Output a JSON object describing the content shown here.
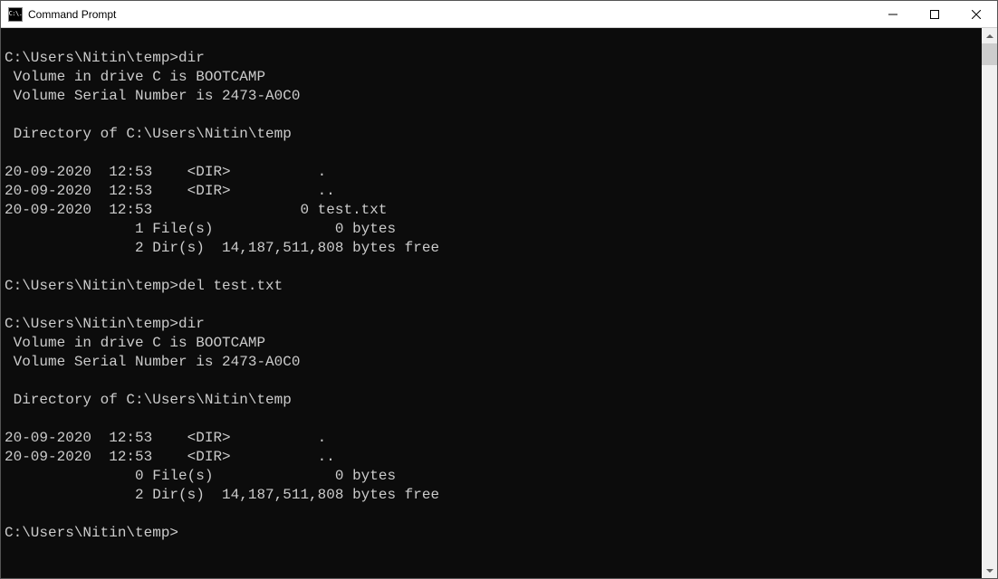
{
  "window": {
    "title": "Command Prompt",
    "icon_text": "C:\\."
  },
  "terminal": {
    "lines": [
      "",
      "C:\\Users\\Nitin\\temp>dir",
      " Volume in drive C is BOOTCAMP",
      " Volume Serial Number is 2473-A0C0",
      "",
      " Directory of C:\\Users\\Nitin\\temp",
      "",
      "20-09-2020  12:53    <DIR>          .",
      "20-09-2020  12:53    <DIR>          ..",
      "20-09-2020  12:53                 0 test.txt",
      "               1 File(s)              0 bytes",
      "               2 Dir(s)  14,187,511,808 bytes free",
      "",
      "C:\\Users\\Nitin\\temp>del test.txt",
      "",
      "C:\\Users\\Nitin\\temp>dir",
      " Volume in drive C is BOOTCAMP",
      " Volume Serial Number is 2473-A0C0",
      "",
      " Directory of C:\\Users\\Nitin\\temp",
      "",
      "20-09-2020  12:53    <DIR>          .",
      "20-09-2020  12:53    <DIR>          ..",
      "               0 File(s)              0 bytes",
      "               2 Dir(s)  14,187,511,808 bytes free",
      "",
      "C:\\Users\\Nitin\\temp>"
    ]
  }
}
